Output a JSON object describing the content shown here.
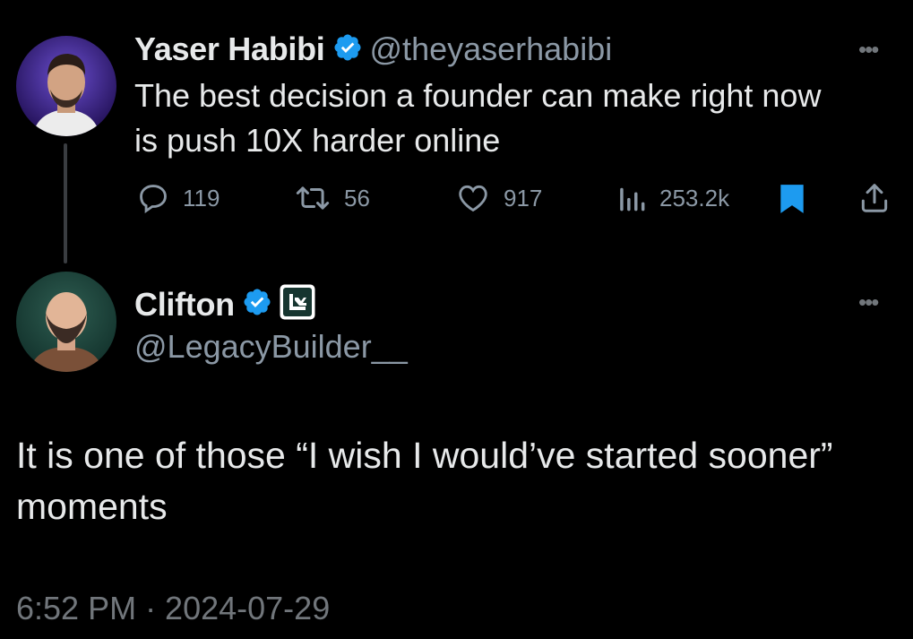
{
  "original_post": {
    "author_name": "Yaser Habibi",
    "author_handle": "@theyaserhabibi",
    "text_line1": "The best decision a founder can make right now",
    "text_line2": "is push 10X harder online",
    "metrics": {
      "replies": "119",
      "reposts": "56",
      "likes": "917",
      "views": "253.2k"
    },
    "bookmarked": true
  },
  "reply_post": {
    "author_name": "Clifton",
    "author_handle": "@LegacyBuilder__",
    "text_line1": "It is one of those “I wish I would’ve started sooner”",
    "text_line2": "moments",
    "timestamp": "6:52 PM · 2024-07-29"
  },
  "icons": {
    "verified": "verified-badge-icon",
    "more": "more-horizontal-icon",
    "reply": "reply-icon",
    "repost": "repost-icon",
    "like": "like-icon",
    "views": "views-icon",
    "bookmark": "bookmark-icon",
    "share": "share-icon",
    "affiliate": "affiliate-badge-icon"
  },
  "colors": {
    "background": "#000000",
    "accent": "#1d9bf0",
    "muted": "#71767b"
  }
}
